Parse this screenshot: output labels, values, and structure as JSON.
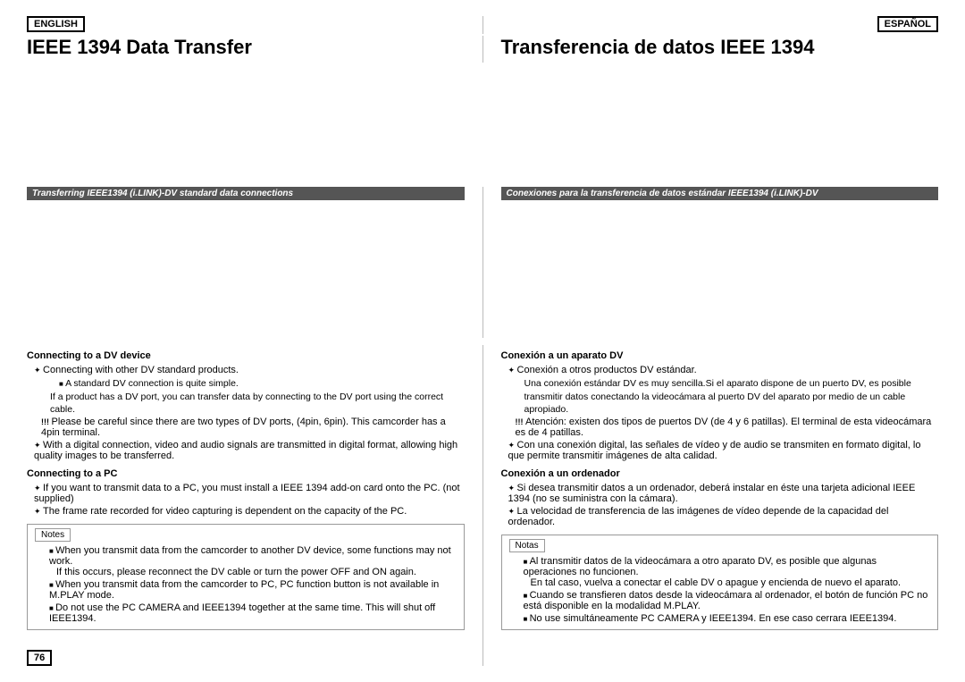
{
  "header": {
    "lang_left": "ENGLISH",
    "lang_right": "ESPAÑOL",
    "title_left": "IEEE 1394 Data Transfer",
    "title_right": "Transferencia de datos IEEE 1394",
    "subtitle_left": "Transferring IEEE1394 (i.LINK)-DV standard data connections",
    "subtitle_right": "Conexiones para la transferencia de datos estándar IEEE1394 (i.LINK)-DV"
  },
  "left": {
    "section1_title": "Connecting to a DV device",
    "s1_b1": "Connecting with other DV standard products.",
    "s1_b1_sub1": "A standard DV connection is quite simple.",
    "s1_b1_sub2": "If a product has a DV port, you can transfer data by connecting to the DV port using the correct cable.",
    "s1_warn1": "Please be careful since there are two types of DV ports, (4pin, 6pin). This camcorder has a 4pin terminal.",
    "s1_b2": "With a digital connection, video and audio signals are transmitted in digital format, allowing high quality images to be transferred.",
    "section2_title": "Connecting to a PC",
    "s2_b1": "If you want to transmit data to a PC, you must install a IEEE 1394 add-on card onto the PC. (not supplied)",
    "s2_b2": "The frame rate recorded for video capturing is dependent on the capacity of the PC.",
    "notes_label": "Notes",
    "note1": "When you transmit data from the camcorder to another DV device, some functions may not work.",
    "note1_sub": "If this occurs, please reconnect the DV cable or turn the power OFF and ON again.",
    "note2": "When you transmit data from the camcorder to PC, PC function button is not available in M.PLAY mode.",
    "note3": "Do not use the PC CAMERA and IEEE1394 together at the same time. This will shut off IEEE1394.",
    "page_num": "76"
  },
  "right": {
    "section1_title": "Conexión a un aparato DV",
    "s1_b1": "Conexión a otros productos DV estándar.",
    "s1_b1_sub1": "Una conexión estándar DV es muy sencilla.Si el aparato dispone de un puerto DV, es posible transmitir datos conectando la videocámara al puerto DV del aparato por medio de un cable apropiado.",
    "s1_warn1": "Atención: existen dos tipos de puertos DV (de 4 y 6 patillas). El terminal de esta videocámara es de 4 patillas.",
    "s1_b2": "Con una conexión digital, las señales de vídeo y de audio se transmiten en formato digital, lo que permite transmitir imágenes de alta calidad.",
    "section2_title": "Conexión a un ordenador",
    "s2_b1": "Si desea transmitir datos a un ordenador, deberá instalar en éste una tarjeta adicional IEEE 1394 (no se suministra con la cámara).",
    "s2_b2": "La velocidad de transferencia de las imágenes de vídeo depende de la capacidad del ordenador.",
    "notes_label": "Notas",
    "note1": "Al transmitir datos de la videocámara a otro aparato DV, es posible que algunas operaciones no funcionen.",
    "note1_sub": "En tal caso, vuelva a conectar el cable DV o apague y encienda de nuevo el aparato.",
    "note2": "Cuando se transfieren datos desde la videocámara al ordenador, el botón de función PC no está disponible en la modalidad M.PLAY.",
    "note3": "No use simultáneamente PC CAMERA y IEEE1394. En ese caso cerrara IEEE1394."
  }
}
